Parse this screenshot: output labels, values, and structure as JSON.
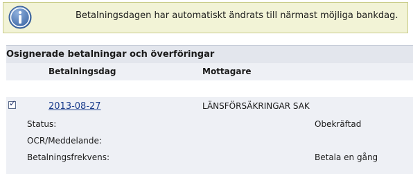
{
  "info_banner": {
    "message": "Betalningsdagen har automatiskt ändrats till närmast möjliga bankdag.",
    "icon": "info-icon"
  },
  "payments_section": {
    "title": "Osignerade betalningar och överföringar",
    "columns": {
      "date": "Betalningsdag",
      "payee": "Mottagare"
    },
    "payments": [
      {
        "selected": true,
        "date": "2013-08-27",
        "payee": "LÄNSFÖRSÄKRINGAR SAK",
        "details": {
          "status_label": "Status:",
          "status_value": "Obekräftad",
          "ocr_label": "OCR/Meddelande:",
          "ocr_value": "",
          "frequency_label": "Betalningsfrekvens:",
          "frequency_value": "Betala en gång"
        }
      }
    ]
  },
  "colors": {
    "banner_bg": "#f2f3d6",
    "banner_border": "#c9cc8a",
    "info_icon": "#4f79b3",
    "header_bg": "#e3e6ed",
    "row_bg": "#eef0f5",
    "link": "#1a3c8c"
  }
}
